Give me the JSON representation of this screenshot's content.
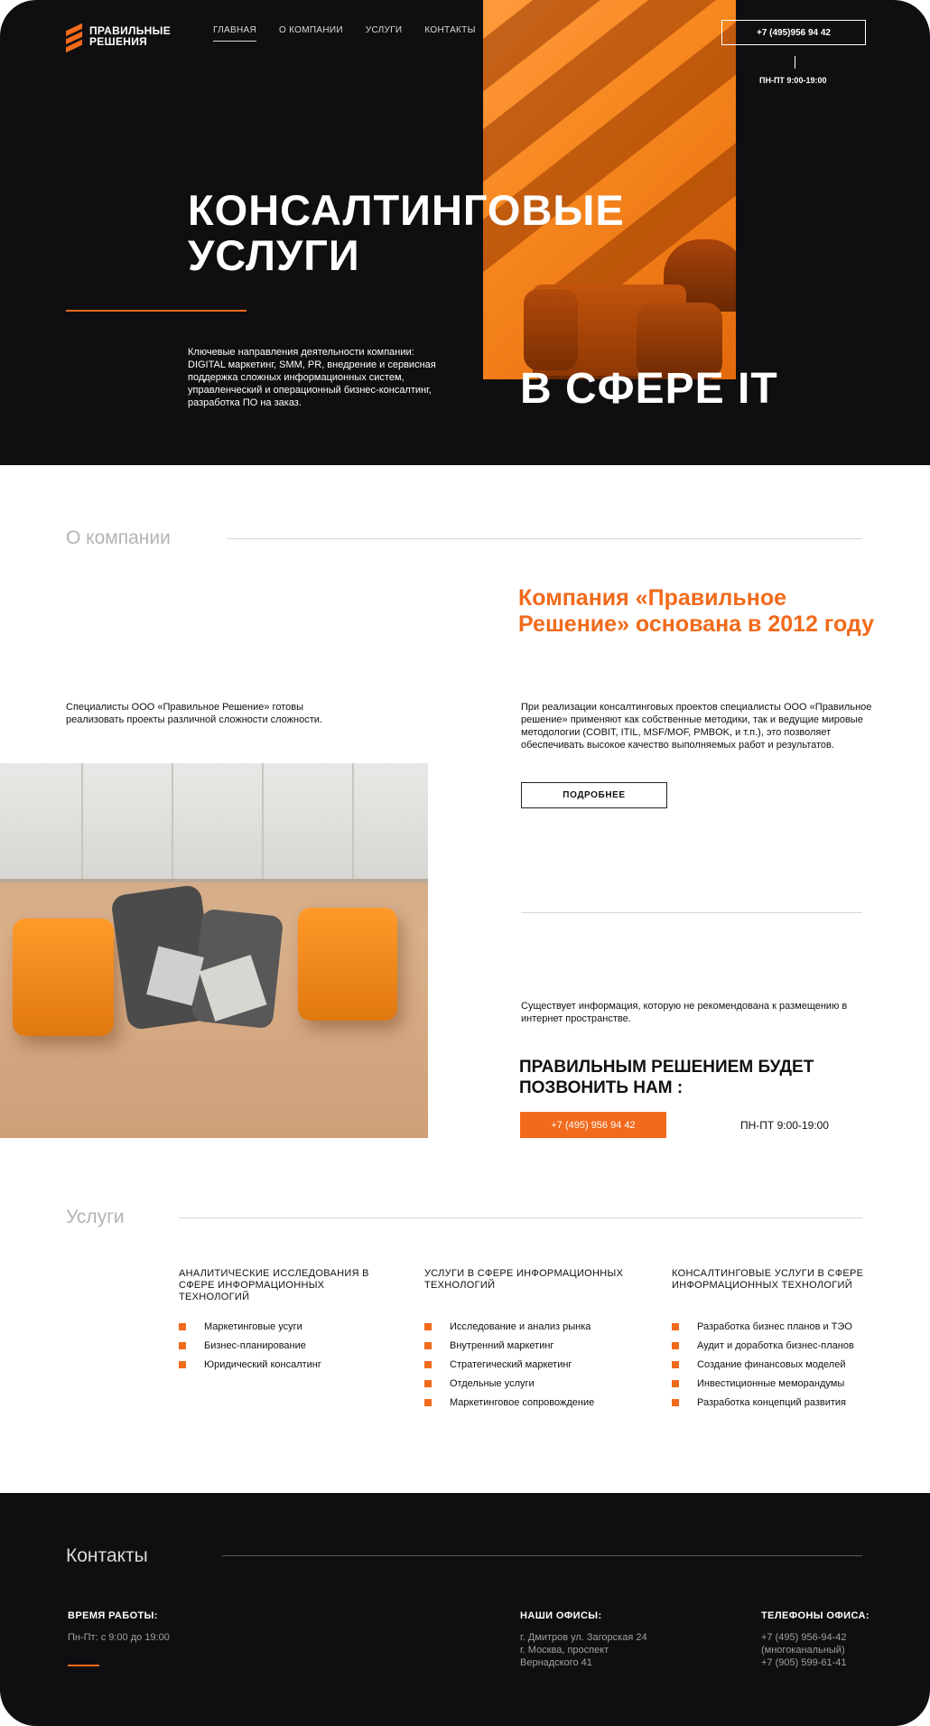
{
  "brand": {
    "name": "ПРАВИЛЬНЫЕ РЕШЕНИЯ",
    "accent": "#f26a1b",
    "dark": "#0f0f11"
  },
  "nav": {
    "items": [
      "ГЛАВНАЯ",
      "О КОМПАНИИ",
      "УСЛУГИ",
      "КОНТАКТЫ"
    ],
    "active": "ГЛАВНАЯ"
  },
  "header": {
    "phone": "+7 (495)956 94 42",
    "hours": "ПН-ПТ 9:00-19:00"
  },
  "hero": {
    "title": "КОНСАЛТИНГОВЫЕ УСЛУГИ",
    "title_suffix": "В СФЕРЕ IT",
    "description": "Ключевые направления деятельности компании: DIGITAL маркетинг, SMM, PR, внедрение и сервисная поддержка сложных информационных систем, управленческий и операционный бизнес-консалтинг, разработка ПО на заказ."
  },
  "about": {
    "section_title": "О компании",
    "heading": "Компания «Правильное Решение» основана в 2012 году",
    "lead": "Специалисты ООО «Правильное Решение» готовы реализовать проекты различной сложности сложности.",
    "text": "При реализации консалтинговых проектов специалисты ООО «Правильное решение» применяют как собственные методики, так и ведущие мировые методологии (COBIT, ITIL, MSF/MOF, PMBOK, и т.п.), это позволяет обеспечивать высокое качество выполняемых работ и результатов.",
    "more_button": "ПОДРОБНЕЕ",
    "note": "Существует информация, которую не рекомендована к размещению в интернет пространстве.",
    "call_title": "ПРАВИЛЬНЫМ РЕШЕНИЕМ БУДЕТ ПОЗВОНИТЬ НАМ :",
    "call_phone": "+7 (495) 956 94 42",
    "call_hours": "ПН-ПТ 9:00-19:00"
  },
  "services": {
    "section_title": "Услуги",
    "columns": [
      {
        "title": "АНАЛИТИЧЕСКИЕ ИССЛЕДОВАНИЯ В СФЕРЕ ИНФОРМАЦИОННЫХ ТЕХНОЛОГИЙ",
        "items": [
          "Маркетинговые усуги",
          "Бизнес-планирование",
          "Юридический консалтинг"
        ]
      },
      {
        "title": "УСЛУГИ В СФЕРЕ ИНФОРМАЦИОННЫХ ТЕХНОЛОГИЙ",
        "items": [
          "Исследование и анализ рынка",
          "Внутренний маркетинг",
          "Стратегический маркетинг",
          "Отдельные услуги",
          "Маркетинговое сопровождение"
        ]
      },
      {
        "title": "КОНСАЛТИНГОВЫЕ УСЛУГИ В СФЕРЕ ИНФОРМАЦИОННЫХ ТЕХНОЛОГИЙ",
        "items": [
          "Разработка бизнес планов и ТЭО",
          "Аудит и доработка бизнес-планов",
          "Создание финансовых моделей",
          "Инвестиционные меморандумы",
          "Разработка концепций развития"
        ]
      }
    ]
  },
  "contacts": {
    "section_title": "Контакты",
    "hours_label": "ВРЕМЯ РАБОТЫ:",
    "hours_value": "Пн-Пт: с 9:00 до 19:00",
    "offices_label": "НАШИ ОФИСЫ:",
    "offices": [
      "г. Дмитров ул. Загорская 24",
      "г. Москва, проспект",
      "Вернадского 41"
    ],
    "phones_label": "ТЕЛЕФОНЫ ОФИСА:",
    "phones": [
      "+7 (495) 956-94-42",
      "(многоканальный)",
      "+7 (905) 599-61-41"
    ]
  }
}
